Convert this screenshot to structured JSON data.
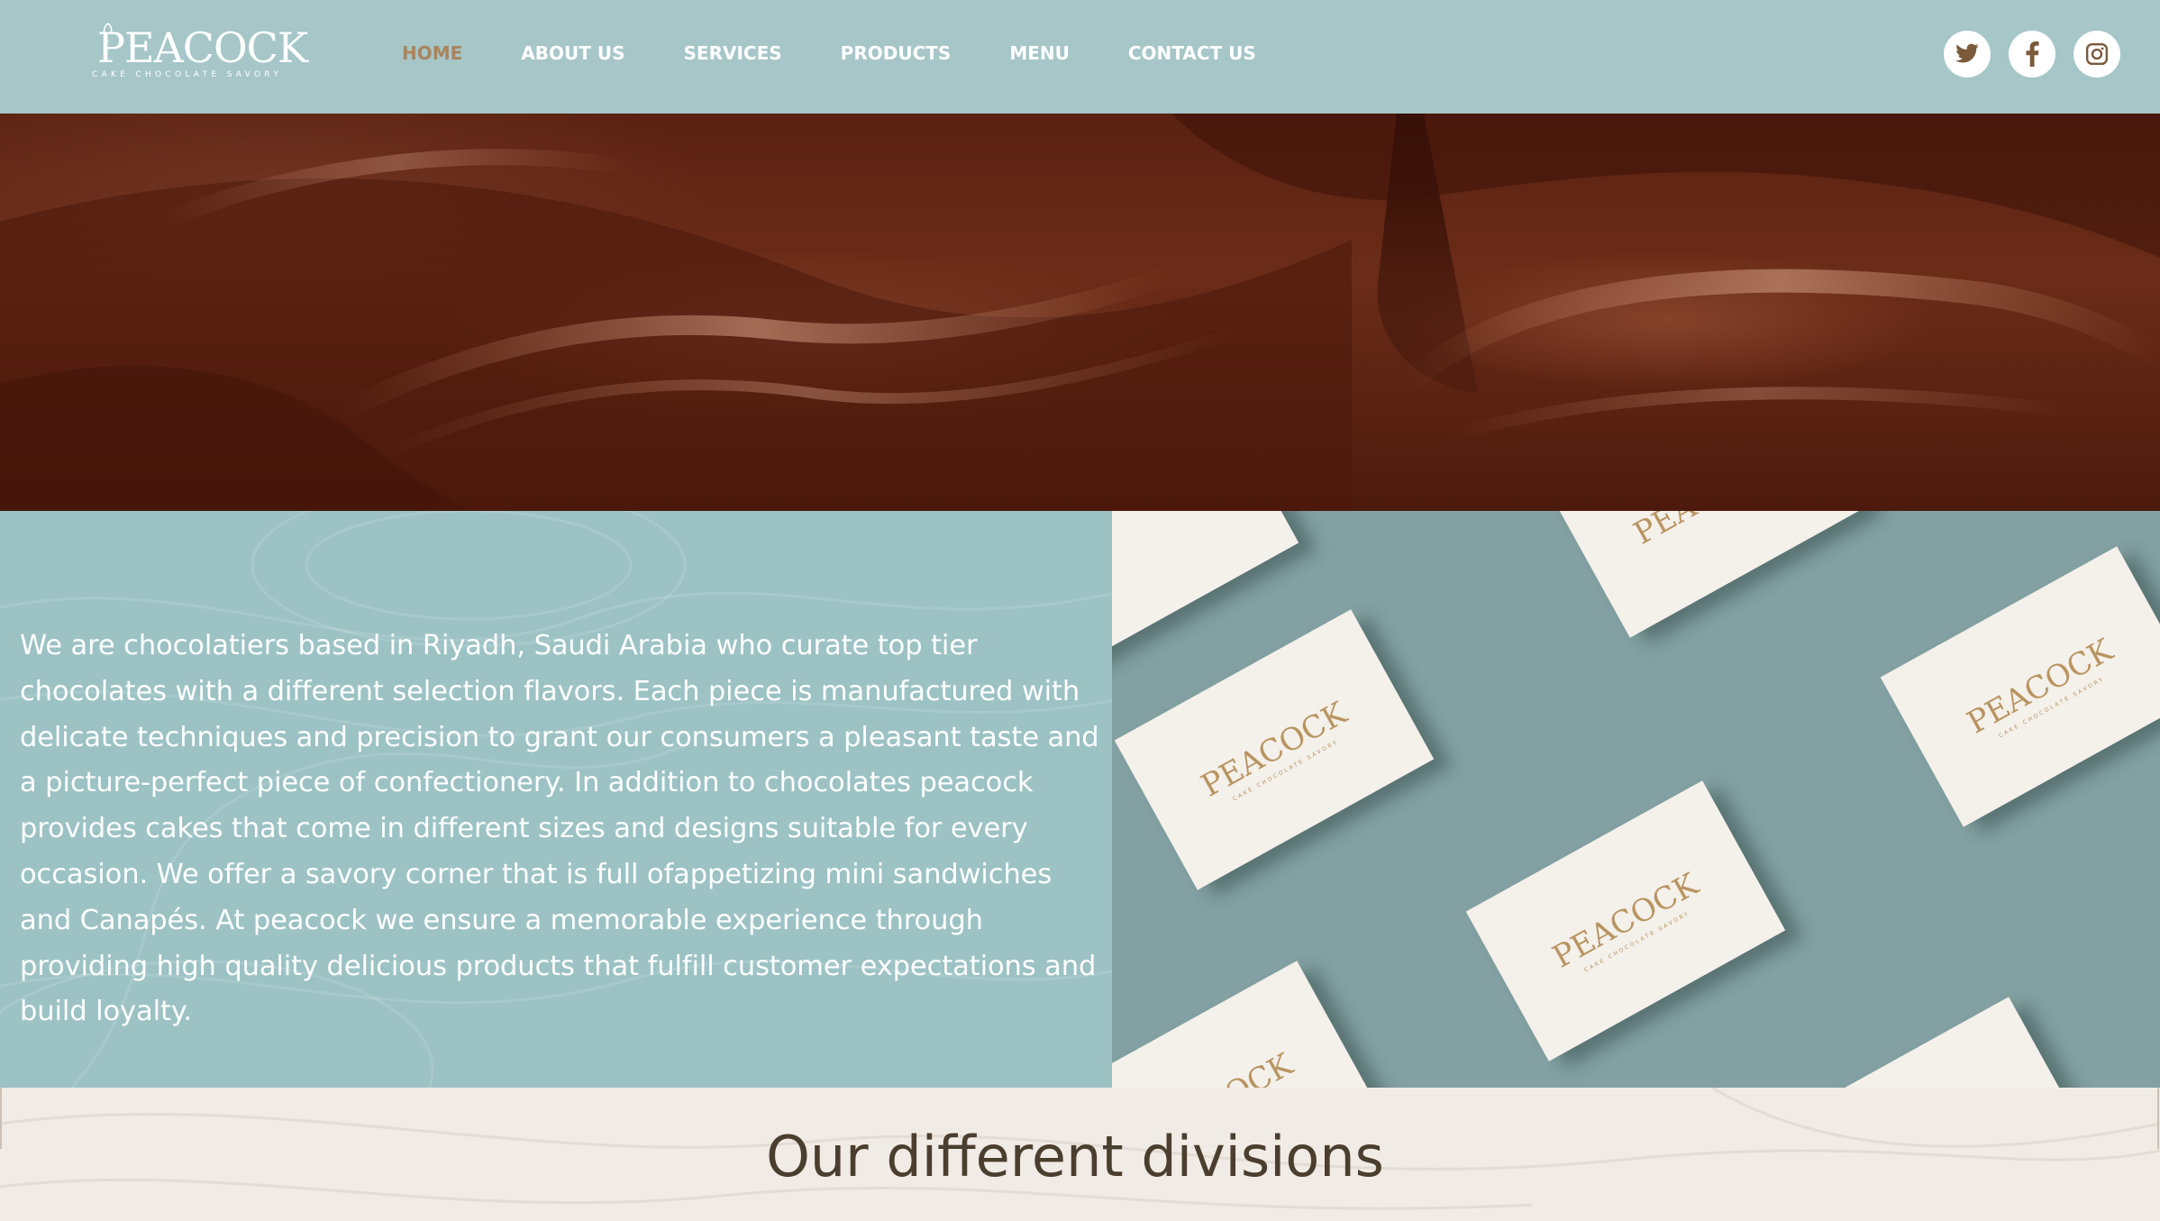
{
  "brand": {
    "name": "PEACOCK",
    "tagline": "CAKE CHOCOLATE SAVORY"
  },
  "nav": {
    "items": [
      {
        "label": "HOME",
        "active": true
      },
      {
        "label": "ABOUT US",
        "active": false
      },
      {
        "label": "SERVICES",
        "active": false
      },
      {
        "label": "PRODUCTS",
        "active": false
      },
      {
        "label": "MENU",
        "active": false
      },
      {
        "label": "CONTACT US",
        "active": false
      }
    ],
    "active_color": "#a9845e"
  },
  "social": [
    {
      "icon": "twitter-icon"
    },
    {
      "icon": "facebook-icon"
    },
    {
      "icon": "instagram-icon"
    }
  ],
  "about": {
    "text": "We are chocolatiers based in Riyadh, Saudi Arabia who curate top tier chocolates with a different selection flavors. Each piece is manufactured with delicate techniques and precision to grant our consumers a pleasant taste and a picture-perfect piece of confectionery. In addition to chocolates peacock provides cakes that come in different sizes and designs suitable for every occasion. We offer a savory corner that is full ofappetizing mini sandwiches and Canapés. At peacock we ensure a memorable experience through providing high quality delicious products that fulfill customer expectations and build loyalty."
  },
  "cards": {
    "logo": "PEACOCK",
    "tagline": "CAKE CHOCOLATE SAVORY"
  },
  "divisions": {
    "title": "Our different divisions"
  },
  "colors": {
    "header_bg": "#a6c6c8",
    "about_bg": "#9cc2c4",
    "cards_bg": "#83a1a2",
    "divisions_bg": "#f1ebe5",
    "heading_text": "#4a3e2e",
    "chocolate": "#5a2112"
  }
}
